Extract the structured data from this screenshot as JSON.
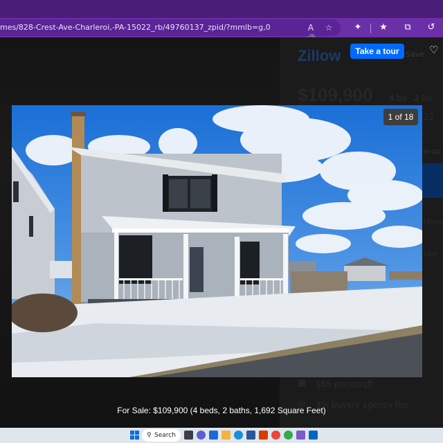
{
  "browser": {
    "url": "mes/828-Crest-Ave-Charleroi,-PA-15022_rb/49760137_zpid/?mmlb=g,0",
    "url_icons": [
      "read-aloud-icon",
      "add-favorite-icon"
    ],
    "toolbar_icons": [
      "extensions-icon",
      "favorites-icon",
      "collections-icon",
      "history-icon"
    ]
  },
  "listing_page": {
    "logo": "Zillow",
    "tour_button": "Take a tour",
    "save_label": "Save",
    "price": "$109,900",
    "beds_value": "4",
    "beds_unit": "bd",
    "baths_value": "2",
    "baths_unit": "ba",
    "zip_fragment": "22",
    "question_fragment": "e-qu",
    "home_fragment": "Home",
    "ider_fragment": "ider",
    "price_per_sqft": "$65 price/sqft",
    "agency_fee": "3% buyers agency fee"
  },
  "lightbox": {
    "counter": "1 of 18",
    "caption": "For Sale: $109,900 (4 beds, 2 baths, 1,692 Square Feet)"
  },
  "taskbar": {
    "search_label": "Search",
    "icons": [
      "task-view-icon",
      "chat-icon",
      "widgets-icon",
      "file-explorer-icon",
      "edge-icon",
      "store-icon",
      "word-icon",
      "office-icon",
      "chrome-icon",
      "photos-icon",
      "app-icon"
    ]
  }
}
